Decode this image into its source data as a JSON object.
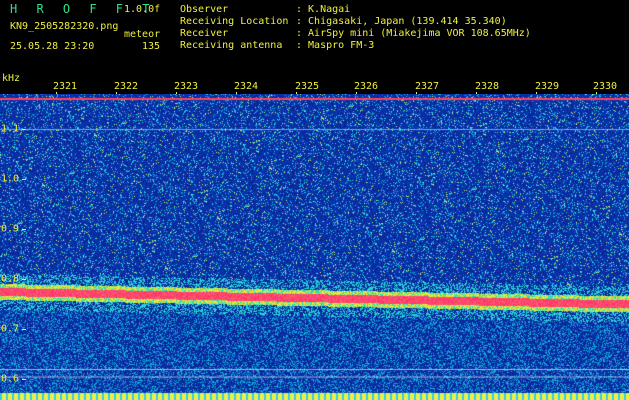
{
  "header": {
    "brand": "H R O F F T",
    "version": "1.0.0f",
    "filename": "KN9_2505282320.png",
    "mode": "meteor",
    "datetime": "25.05.28 23:20",
    "count": "135",
    "fields": [
      {
        "label": "Observer",
        "value": ": K.Nagai"
      },
      {
        "label": "Receiving Location",
        "value": ": Chigasaki, Japan (139.414 35.340)"
      },
      {
        "label": "Receiver",
        "value": ": AirSpy mini (Miakejima VOR 108.65MHz)"
      },
      {
        "label": "Receiving antenna",
        "value": ": Maspro FM-3"
      }
    ]
  },
  "plot": {
    "y_unit": "kHz",
    "y_range": [
      0.58,
      1.17
    ],
    "y_ticks": [
      "1.1",
      "1.0",
      "0.9",
      "0.8",
      "0.7",
      "0.6"
    ],
    "time_ticks": [
      "2321",
      "2322",
      "2323",
      "2324",
      "2325",
      "2326",
      "2327",
      "2328",
      "2329",
      "2330"
    ],
    "signal_band_khz": [
      0.775,
      0.75
    ],
    "colors": {
      "background": "#0a2aa0",
      "accent": "#f0f040",
      "label": "#2fe08a",
      "signal": "#ff3070"
    }
  }
}
